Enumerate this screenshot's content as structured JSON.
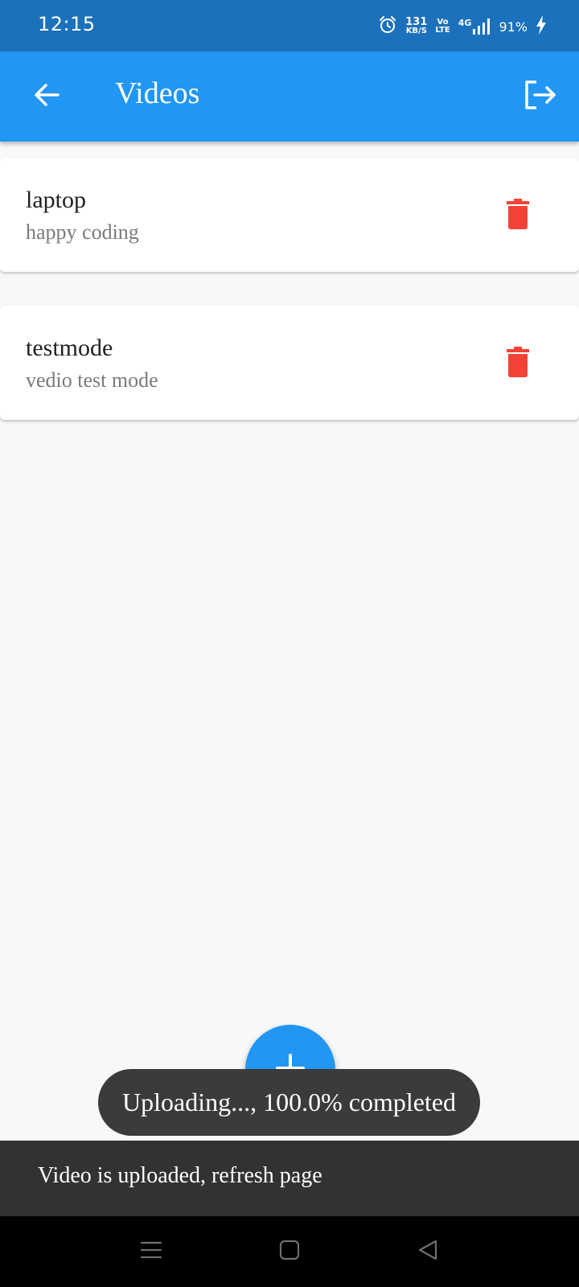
{
  "status_bar": {
    "time": "12:15",
    "net_speed_value": "131",
    "net_speed_unit": "KB/S",
    "volte_top": "Vo",
    "volte_bottom": "LTE",
    "network_type": "4G",
    "battery": "91%",
    "icons": [
      "alarm-icon",
      "signal-icon",
      "charging-icon"
    ]
  },
  "app_bar": {
    "title": "Videos",
    "back_icon": "arrow-back-icon",
    "logout_icon": "logout-icon",
    "color": "#2196f3"
  },
  "videos": [
    {
      "title": "laptop",
      "subtitle": "happy coding",
      "action_icon": "trash-icon"
    },
    {
      "title": "testmode",
      "subtitle": "vedio test mode",
      "action_icon": "trash-icon"
    }
  ],
  "fab": {
    "icon": "plus-icon",
    "color": "#2196f3"
  },
  "toast": {
    "text": "Uploading..., 100.0% completed",
    "progress_percent": 100.0
  },
  "snackbar": {
    "text": "Video is uploaded, refresh page"
  },
  "nav_bar": {
    "icons": [
      "menu-icon",
      "home-square-icon",
      "back-triangle-icon"
    ]
  },
  "colors": {
    "delete": "#f44336",
    "status_bar": "#1b71bb",
    "snackbar": "#323232"
  }
}
